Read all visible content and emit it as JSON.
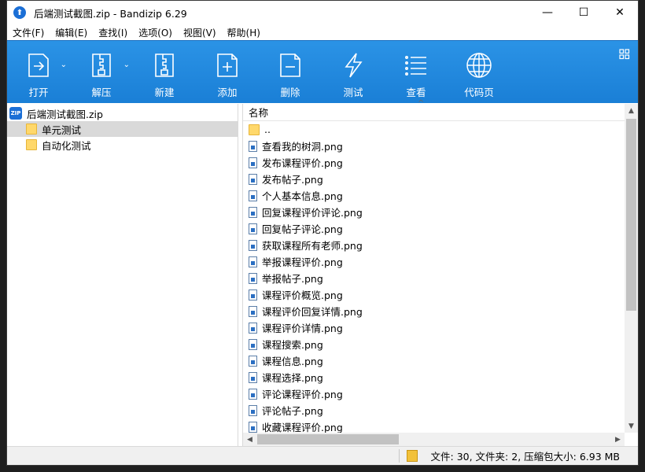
{
  "window": {
    "title": "后端测试截图.zip - Bandizip 6.29",
    "controls": {
      "minimize": "—",
      "maximize": "☐",
      "close": "✕"
    }
  },
  "menubar": {
    "items": [
      "文件(F)",
      "编辑(E)",
      "查找(I)",
      "选项(O)",
      "视图(V)",
      "帮助(H)"
    ]
  },
  "toolbar": {
    "buttons": [
      {
        "label": "打开",
        "icon": "open-icon"
      },
      {
        "label": "解压",
        "icon": "extract-icon"
      },
      {
        "label": "新建",
        "icon": "new-archive-icon"
      },
      {
        "label": "添加",
        "icon": "add-icon"
      },
      {
        "label": "删除",
        "icon": "delete-icon"
      },
      {
        "label": "测试",
        "icon": "test-icon"
      },
      {
        "label": "查看",
        "icon": "view-icon"
      },
      {
        "label": "代码页",
        "icon": "globe-icon"
      }
    ],
    "colors": {
      "bg": "#1a7fd6",
      "text": "#ffffff"
    }
  },
  "tree": {
    "root": "后端测试截图.zip",
    "items": [
      {
        "label": "单元测试",
        "selected": true
      },
      {
        "label": "自动化测试",
        "selected": false
      }
    ]
  },
  "list": {
    "column_header": "名称",
    "parent": "..",
    "files": [
      "查看我的树洞.png",
      "发布课程评价.png",
      "发布帖子.png",
      "个人基本信息.png",
      "回复课程评价评论.png",
      "回复帖子评论.png",
      "获取课程所有老师.png",
      "举报课程评价.png",
      "举报帖子.png",
      "课程评价概览.png",
      "课程评价回复详情.png",
      "课程评价详情.png",
      "课程搜索.png",
      "课程信息.png",
      "课程选择.png",
      "评论课程评价.png",
      "评论帖子.png",
      "收藏课程评价.png"
    ]
  },
  "statusbar": {
    "text": "文件: 30, 文件夹: 2, 压缩包大小: 6.93 MB"
  }
}
